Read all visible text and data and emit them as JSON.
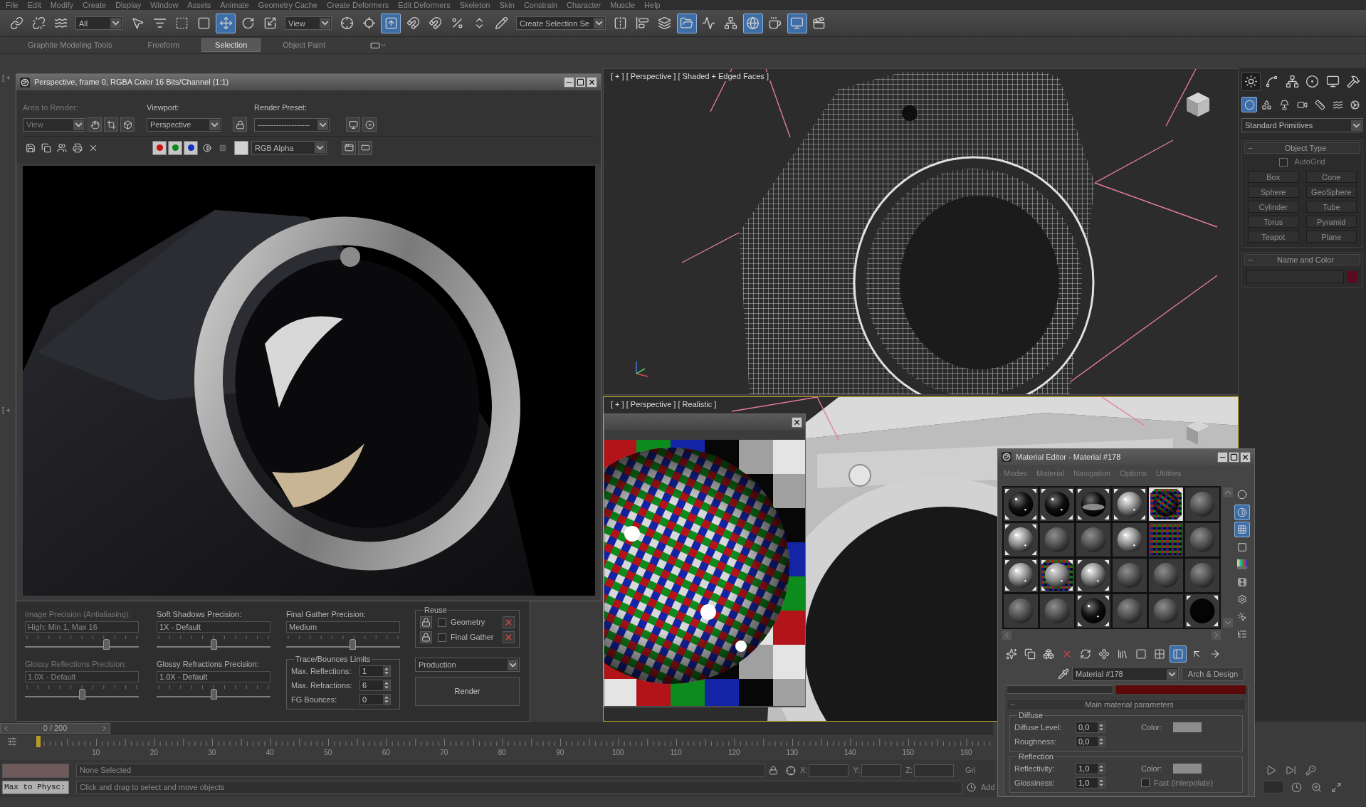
{
  "menu_bar": [
    "File",
    "Edit",
    "Modify",
    "Create",
    "Display",
    "Window",
    "Assets",
    "Animate",
    "Geometry Cache",
    "Create Deformers",
    "Edit Deformers",
    "Skeleton",
    "Skin",
    "Constrain",
    "Character",
    "Muscle",
    "Help"
  ],
  "main_toolbar": [
    {
      "kind": "link",
      "selected": false
    },
    {
      "kind": "unlink",
      "selected": false
    },
    {
      "kind": "bind",
      "selected": false
    },
    {
      "kind": "dropdown",
      "value": "All"
    },
    {
      "kind": "select",
      "selected": false
    },
    {
      "kind": "select_by_name",
      "selected": false
    },
    {
      "kind": "region",
      "selected": false
    },
    {
      "kind": "crossing",
      "selected": false
    },
    {
      "kind": "move",
      "selected": true
    },
    {
      "kind": "rotate",
      "selected": false
    },
    {
      "kind": "scale",
      "selected": false
    },
    {
      "kind": "dropdown",
      "value": "View"
    },
    {
      "kind": "pivot",
      "selected": false
    },
    {
      "kind": "manipulate",
      "selected": false
    },
    {
      "kind": "override",
      "selected": true
    },
    {
      "kind": "snap",
      "selected": false
    },
    {
      "kind": "angle_snap",
      "selected": false
    },
    {
      "kind": "percent_snap",
      "selected": false
    },
    {
      "kind": "spinner_snap",
      "selected": false
    },
    {
      "kind": "edit_selection",
      "selected": false
    },
    {
      "kind": "dropdown",
      "value": "Create Selection Se"
    },
    {
      "kind": "mirror",
      "selected": false
    },
    {
      "kind": "align",
      "selected": false
    },
    {
      "kind": "layers",
      "selected": false
    },
    {
      "kind": "explorer",
      "selected": true
    },
    {
      "kind": "curve_editor",
      "selected": false
    },
    {
      "kind": "schematic",
      "selected": false
    },
    {
      "kind": "material_editor",
      "selected": true
    },
    {
      "kind": "render_setup",
      "selected": false
    },
    {
      "kind": "frame_window",
      "selected": true
    },
    {
      "kind": "render",
      "selected": false
    }
  ],
  "ribbon": [
    {
      "label": "Graphite Modeling Tools",
      "selected": false
    },
    {
      "label": "Freeform",
      "selected": false
    },
    {
      "label": "Selection",
      "selected": true
    },
    {
      "label": "Object Paint",
      "selected": false
    }
  ],
  "left_viewport_labels": [
    "[ +",
    "[ +"
  ],
  "viewports": [
    {
      "kind": "wireframe",
      "label": "[ + ] [ Perspective ] [ Shaded + Edged Faces ]",
      "active": false
    },
    {
      "kind": "realistic",
      "label": "[ + ] [ Perspective ] [ Realistic ]",
      "active": true
    }
  ],
  "command_panel": {
    "tabs": [
      {
        "kind": "create",
        "selected": true
      },
      {
        "kind": "modify",
        "selected": false
      },
      {
        "kind": "hierarchy",
        "selected": false
      },
      {
        "kind": "motion",
        "selected": false
      },
      {
        "kind": "display",
        "selected": false
      },
      {
        "kind": "utilities",
        "selected": false
      }
    ],
    "categories": [
      {
        "kind": "geometry",
        "selected": true
      },
      {
        "kind": "shapes",
        "selected": false
      },
      {
        "kind": "lights",
        "selected": false
      },
      {
        "kind": "cameras",
        "selected": false
      },
      {
        "kind": "helpers",
        "selected": false
      },
      {
        "kind": "spacewarps",
        "selected": false
      },
      {
        "kind": "systems",
        "selected": false
      }
    ],
    "subcategory": "Standard Primitives",
    "object_type_title": "Object Type",
    "autogrid": {
      "label": "AutoGrid",
      "checked": false
    },
    "object_buttons": [
      "Box",
      "Cone",
      "Sphere",
      "GeoSphere",
      "Cylinder",
      "Tube",
      "Torus",
      "Pyramid",
      "Teapot",
      "Plane"
    ],
    "name_color_title": "Name and Color"
  },
  "render_window": {
    "title": "Perspective, frame 0, RGBA Color 16 Bits/Channel (1:1)",
    "area_label": "Area to Render:",
    "area_value": "View",
    "area_disabled": true,
    "viewport_label": "Viewport:",
    "viewport_value": "Perspective",
    "preset_label": "Render Preset:",
    "preset_value": "--------------------",
    "channels": [
      {
        "color": "#cc1111",
        "on": true
      },
      {
        "color": "#0a8a1a",
        "on": true
      },
      {
        "color": "#1030c0",
        "on": true
      }
    ],
    "display_channel": "RGB Alpha",
    "precision": [
      {
        "label": "Image Precision (Antialiasing):",
        "value": "High: Min 1, Max 16",
        "level": 0.73,
        "disabled": true
      },
      {
        "label": "Soft Shadows Precision:",
        "value": "1X - Default",
        "level": 0.5,
        "disabled": false
      },
      {
        "label": "Final Gather Precision:",
        "value": "Medium",
        "level": 0.59,
        "disabled": false
      },
      {
        "label": "Glossy Reflections Precision:",
        "value": "1.0X - Default",
        "level": 0.5,
        "disabled": true
      },
      {
        "label": "Glossy Refractions Precision:",
        "value": "1.0X - Default",
        "level": 0.5,
        "disabled": false
      }
    ],
    "trace_title": "Trace/Bounces Limits",
    "trace_fields": [
      {
        "label": "Max. Reflections:",
        "value": "1"
      },
      {
        "label": "Max. Refractions:",
        "value": "6"
      },
      {
        "label": "FG Bounces:",
        "value": "0"
      }
    ],
    "reuse_title": "Reuse",
    "reuse": [
      {
        "label": "Geometry",
        "checked": false
      },
      {
        "label": "Final Gather",
        "checked": false
      }
    ],
    "mode": "Production",
    "render_button": "Render"
  },
  "material_editor": {
    "title": "Material Editor - Material #178",
    "menus": [
      "Modes",
      "Material",
      "Navigation",
      "Options",
      "Utilities"
    ],
    "slots": [
      {
        "kind": "black",
        "assigned": true,
        "selected": false
      },
      {
        "kind": "black",
        "assigned": true,
        "selected": false
      },
      {
        "kind": "cup",
        "assigned": true,
        "selected": false
      },
      {
        "kind": "glossy",
        "assigned": true,
        "selected": false
      },
      {
        "kind": "checker_sphere",
        "assigned": true,
        "selected": true
      },
      {
        "kind": "matte",
        "assigned": false,
        "selected": false
      },
      {
        "kind": "glossy",
        "assigned": true,
        "selected": false
      },
      {
        "kind": "matte",
        "assigned": false,
        "selected": false
      },
      {
        "kind": "matte",
        "assigned": false,
        "selected": false
      },
      {
        "kind": "glossy",
        "assigned": false,
        "selected": false
      },
      {
        "kind": "checker",
        "assigned": false,
        "selected": false
      },
      {
        "kind": "matte",
        "assigned": false,
        "selected": false
      },
      {
        "kind": "glossy",
        "assigned": true,
        "selected": false
      },
      {
        "kind": "sphere_on_checker",
        "assigned": true,
        "selected": false
      },
      {
        "kind": "glossy",
        "assigned": true,
        "selected": false
      },
      {
        "kind": "matte",
        "assigned": false,
        "selected": false
      },
      {
        "kind": "matte",
        "assigned": false,
        "selected": false
      },
      {
        "kind": "matte",
        "assigned": false,
        "selected": false
      },
      {
        "kind": "matte",
        "assigned": false,
        "selected": false
      },
      {
        "kind": "matte",
        "assigned": false,
        "selected": false
      },
      {
        "kind": "black",
        "assigned": true,
        "selected": false
      },
      {
        "kind": "matte",
        "assigned": false,
        "selected": false
      },
      {
        "kind": "matte",
        "assigned": false,
        "selected": false
      },
      {
        "kind": "void",
        "assigned": true,
        "selected": false
      }
    ],
    "side_tools": [
      {
        "kind": "sample_type"
      },
      {
        "kind": "backlight",
        "pressed": true
      },
      {
        "kind": "background",
        "pressed": true
      },
      {
        "kind": "tiling"
      },
      {
        "kind": "video_check"
      },
      {
        "kind": "preview"
      },
      {
        "kind": "options"
      },
      {
        "kind": "select_by_material"
      },
      {
        "kind": "navigator"
      }
    ],
    "tools": [
      {
        "kind": "get",
        "selected": false
      },
      {
        "kind": "put",
        "selected": false
      },
      {
        "kind": "assign",
        "selected": false
      },
      {
        "kind": "reset",
        "selected": false
      },
      {
        "kind": "make_copy",
        "selected": false
      },
      {
        "kind": "unique",
        "selected": false
      },
      {
        "kind": "library",
        "selected": false
      },
      {
        "kind": "effects",
        "selected": false
      },
      {
        "kind": "show_map",
        "selected": false
      },
      {
        "kind": "end_result",
        "selected": true
      },
      {
        "kind": "parent",
        "selected": false
      },
      {
        "kind": "sibling",
        "selected": false
      }
    ],
    "material_name": "Material #178",
    "material_type": "Arch & Design",
    "rollout_title": "Main material parameters",
    "groups": [
      {
        "title": "Diffuse",
        "rows": [
          {
            "label": "Diffuse Level:",
            "value": "0,0",
            "color_label": "Color:"
          },
          {
            "label": "Roughness:",
            "value": "0,0"
          }
        ]
      },
      {
        "title": "Reflection",
        "rows": [
          {
            "label": "Reflectivity:",
            "value": "1,0",
            "color_label": "Color:"
          },
          {
            "label": "Glossiness:",
            "value": "1,0",
            "option": "Fast (interpolate)",
            "checked": false
          }
        ]
      }
    ]
  },
  "timeline": {
    "slider_label": "0 / 200",
    "level": 0,
    "labels": [
      "10",
      "20",
      "30",
      "40",
      "50",
      "60",
      "70",
      "80",
      "90",
      "100",
      "110",
      "120",
      "130",
      "140",
      "150",
      "160"
    ]
  },
  "status_bar": {
    "listener": "Max to Physc:",
    "selection": "None Selected",
    "prompt": "Click and drag to select and move objects",
    "coord_labels": [
      "X:",
      "Y:",
      "Z:"
    ],
    "grid": "Gri",
    "add": "Add"
  }
}
